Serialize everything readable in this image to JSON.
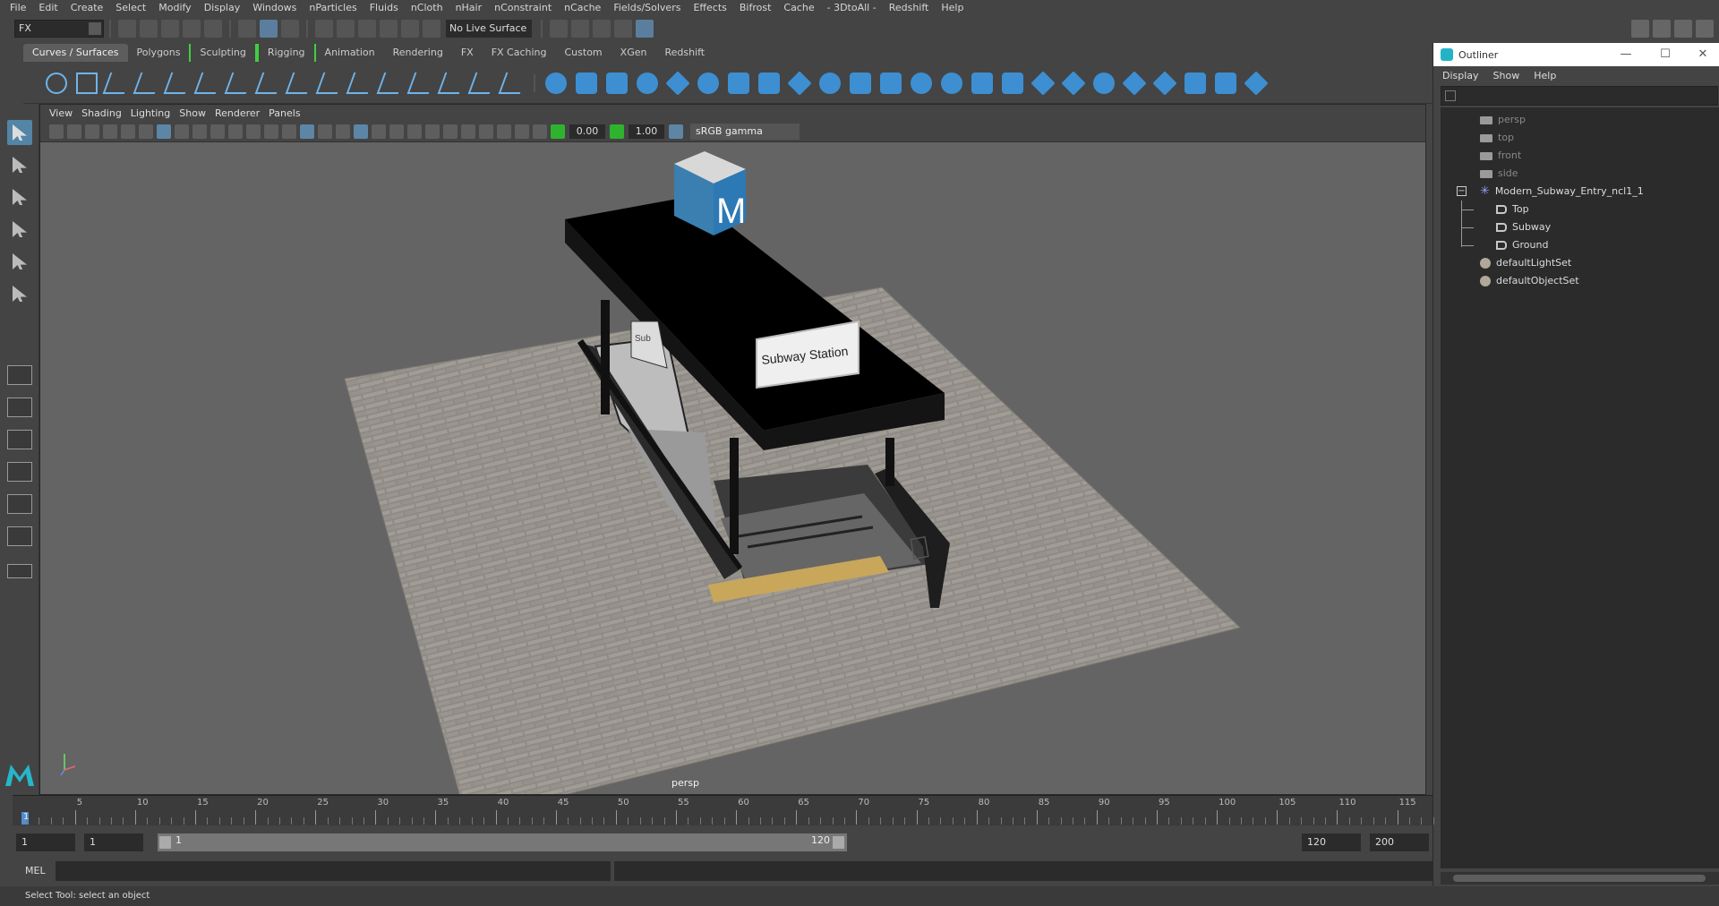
{
  "menubar": [
    "File",
    "Edit",
    "Create",
    "Select",
    "Modify",
    "Display",
    "Windows",
    "nParticles",
    "Fluids",
    "nCloth",
    "nHair",
    "nConstraint",
    "nCache",
    "Fields/Solvers",
    "Effects",
    "Bifrost",
    "Cache",
    "- 3DtoAll -",
    "Redshift",
    "Help"
  ],
  "statusline": {
    "mode": "FX",
    "live_surface": "No Live Surface"
  },
  "shelf_tabs": [
    "Curves / Surfaces",
    "Polygons",
    "Sculpting",
    "Rigging",
    "Animation",
    "Rendering",
    "FX",
    "FX Caching",
    "Custom",
    "XGen",
    "Redshift"
  ],
  "panel_menu": [
    "View",
    "Shading",
    "Lighting",
    "Show",
    "Renderer",
    "Panels"
  ],
  "panel_toolbar": {
    "exposure": "0.00",
    "gamma": "1.00",
    "colorspace": "sRGB gamma"
  },
  "viewport": {
    "camera": "persp",
    "scene_texts": {
      "sign_top": "M",
      "sign_side": "Subway Station"
    }
  },
  "outliner": {
    "title": "Outliner",
    "window_buttons": {
      "minimize": "—",
      "maximize": "☐",
      "close": "✕"
    },
    "menu": [
      "Display",
      "Show",
      "Help"
    ],
    "items": [
      {
        "label": "persp",
        "kind": "camera",
        "dim": true
      },
      {
        "label": "top",
        "kind": "camera",
        "dim": true
      },
      {
        "label": "front",
        "kind": "camera",
        "dim": true
      },
      {
        "label": "side",
        "kind": "camera",
        "dim": true
      },
      {
        "label": "Modern_Subway_Entry_ncl1_1",
        "kind": "root",
        "dim": false
      },
      {
        "label": "Top",
        "kind": "group",
        "dim": false
      },
      {
        "label": "Subway",
        "kind": "group",
        "dim": false
      },
      {
        "label": "Ground",
        "kind": "group",
        "dim": false
      },
      {
        "label": "defaultLightSet",
        "kind": "set",
        "dim": false
      },
      {
        "label": "defaultObjectSet",
        "kind": "set",
        "dim": false
      }
    ]
  },
  "timeline": {
    "labels": [
      "1",
      "5",
      "10",
      "15",
      "20",
      "25",
      "30",
      "35",
      "40",
      "45",
      "50",
      "55",
      "60",
      "65",
      "70",
      "75",
      "80",
      "85",
      "90",
      "95",
      "100",
      "105",
      "110",
      "115"
    ],
    "current_frame": "1"
  },
  "range": {
    "start": "1",
    "playback_start": "1",
    "slider_start": "1",
    "slider_end": "120",
    "playback_end": "120",
    "end": "200"
  },
  "command_line": {
    "lang": "MEL"
  },
  "help_line": "Select Tool: select an object",
  "colors": {
    "accent": "#5285a6",
    "shelf_icon": "#3d8fd1",
    "viewport_bg": "#646464"
  }
}
